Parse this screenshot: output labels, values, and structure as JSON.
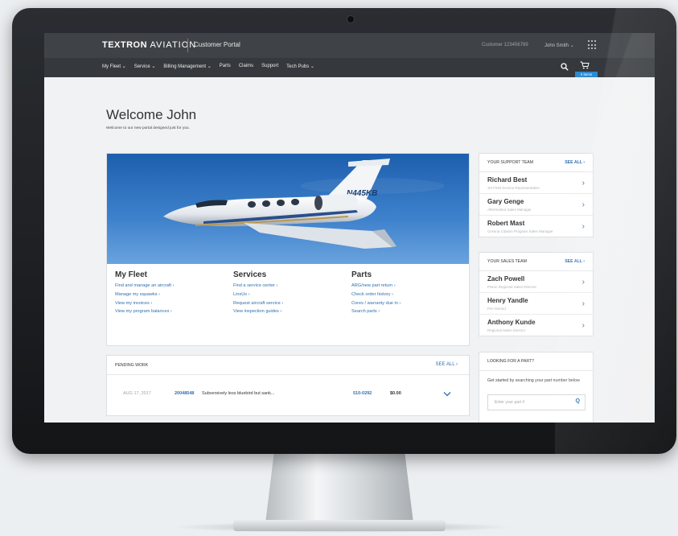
{
  "header": {
    "logo_bold": "TEXTRON",
    "logo_light": "AVIATION",
    "portal_title": "Customer Portal",
    "account": "Customer 123456789",
    "user": "John Smith",
    "user_caret": "⌄"
  },
  "nav": {
    "items": [
      {
        "label": "My Fleet ⌄"
      },
      {
        "label": "Service ⌄"
      },
      {
        "label": "Billing Management ⌄"
      },
      {
        "label": "Parts"
      },
      {
        "label": "Claims"
      },
      {
        "label": "Support"
      },
      {
        "label": "Tech Pubs ⌄"
      }
    ],
    "cart_badge": "0 items"
  },
  "welcome": {
    "title": "Welcome John",
    "subtitle": "Welcome to our new portal designed just for you."
  },
  "hero": {
    "tail_number": "N445KB",
    "columns": [
      {
        "title": "My Fleet",
        "links": [
          "Find and manage an aircraft ›",
          "Manage my squawks ›",
          "View my invoices ›",
          "View my program balances ›"
        ]
      },
      {
        "title": "Services",
        "links": [
          "Find a service center ›",
          "LinxUs ›",
          "Request aircraft service ›",
          "View inspection guides ›"
        ]
      },
      {
        "title": "Parts",
        "links": [
          "ARG/new part return ›",
          "Check order history ›",
          "Cores / warranty due in ›",
          "Search parts ›"
        ]
      }
    ]
  },
  "support_team": {
    "title": "YOUR SUPPORT TEAM",
    "see_all": "SEE ALL ›",
    "people": [
      {
        "name": "Richard Best",
        "role": "Jet Field Service Representative"
      },
      {
        "name": "Gary Genge",
        "role": "Aftermarket Sales Manager"
      },
      {
        "name": "Robert Mast",
        "role": "Cessna Citation Program Sales Manager"
      }
    ]
  },
  "sales_team": {
    "title": "YOUR SALES TEAM",
    "see_all": "SEE ALL ›",
    "people": [
      {
        "name": "Zach Powell",
        "role": "Piston Regional Sales Director"
      },
      {
        "name": "Henry Yandle",
        "role": "Pre-Owned"
      },
      {
        "name": "Anthony Kunde",
        "role": "Regional Sales Director"
      }
    ]
  },
  "part_search": {
    "title": "LOOKING FOR A PART?",
    "text": "Get started by searching your part number below",
    "placeholder": "Enter your part #",
    "icon": "Q"
  },
  "pending_work": {
    "title": "PENDING WORK",
    "see_all": "SEE ALL ›",
    "rows": [
      {
        "date": "AUG 17, 2017",
        "id": "20048548",
        "description": "Subversively less bluebird but sank...",
        "part": "510-0292",
        "amount": "$0.00"
      }
    ]
  },
  "colors": {
    "accent": "#2f6fae",
    "header_bg": "#3f4347",
    "nav_bg": "#35393d",
    "badge": "#2b8ad0"
  }
}
